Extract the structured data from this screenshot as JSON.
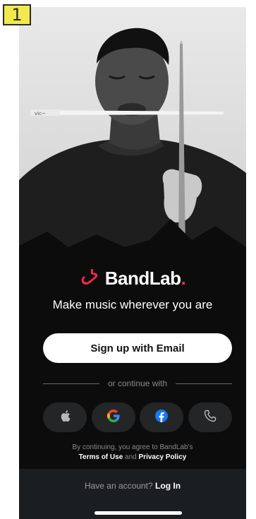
{
  "step_badge": "1",
  "brand": {
    "name": "BandLab",
    "dot": "."
  },
  "tagline": "Make music wherever you are",
  "signup_button": "Sign up with Email",
  "divider_text": "or continue with",
  "social_buttons": [
    {
      "icon": "apple-icon"
    },
    {
      "icon": "google-icon"
    },
    {
      "icon": "facebook-icon"
    },
    {
      "icon": "phone-icon"
    }
  ],
  "legal": {
    "prefix": "By continuing, you agree to BandLab's",
    "terms": "Terms of Use",
    "and": "and",
    "privacy": "Privacy Policy"
  },
  "footer": {
    "question": "Have an account?",
    "login": "Log In"
  },
  "colors": {
    "brand_red": "#f0284a",
    "background": "#0c0c0d",
    "footer": "#1b1e20",
    "social_button": "#232526"
  }
}
